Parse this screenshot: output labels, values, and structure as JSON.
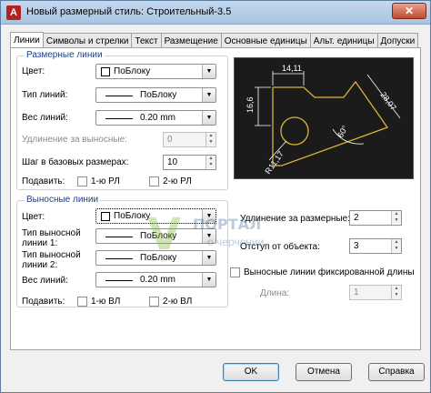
{
  "window": {
    "title": "Новый размерный стиль: Строительный-3.5",
    "icon_letter": "A",
    "close_symbol": "✕"
  },
  "tabs": [
    {
      "label": "Линии",
      "active": true
    },
    {
      "label": "Символы и стрелки"
    },
    {
      "label": "Текст"
    },
    {
      "label": "Размещение"
    },
    {
      "label": "Основные единицы"
    },
    {
      "label": "Альт. единицы"
    },
    {
      "label": "Допуски"
    }
  ],
  "dim_lines": {
    "group_title": "Размерные линии",
    "color_label": "Цвет:",
    "color_value": "ПоБлоку",
    "linetype_label": "Тип линий:",
    "linetype_value": "ПоБлоку",
    "lineweight_label": "Вес линий:",
    "lineweight_value": "0.20 mm",
    "extension_label": "Удлинение за выносные:",
    "extension_value": "0",
    "baseline_label": "Шаг в базовых размерах:",
    "baseline_value": "10",
    "suppress_label": "Подавить:",
    "suppress_1": "1-ю РЛ",
    "suppress_2": "2-ю РЛ"
  },
  "ext_lines": {
    "group_title": "Выносные линии",
    "color_label": "Цвет:",
    "color_value": "ПоБлоку",
    "linetype1_label_a": "Тип выносной",
    "linetype1_label_b": "линии 1:",
    "linetype1_value": "ПоБлоку",
    "linetype2_label_a": "Тип выносной",
    "linetype2_label_b": "линии 2:",
    "linetype2_value": "ПоБлоку",
    "lineweight_label": "Вес линий:",
    "lineweight_value": "0.20 mm",
    "suppress_label": "Подавить:",
    "suppress_1": "1-ю ВЛ",
    "suppress_2": "2-ю ВЛ",
    "extend_label": "Удлинение за размерные:",
    "extend_value": "2",
    "offset_label": "Отступ от объекта:",
    "offset_value": "3",
    "fixed_label": "Выносные линии фиксированной длины",
    "length_label": "Длина:",
    "length_value": "1"
  },
  "preview": {
    "dim_top": "14,11",
    "dim_left": "16,6",
    "dim_right": "28,07",
    "dim_angle": "60°",
    "dim_radius": "R11,17"
  },
  "watermark": {
    "letter": "V",
    "line1": "ПОРТАЛ",
    "line2": "о черчении"
  },
  "buttons": {
    "ok": "OK",
    "cancel": "Отмена",
    "help": "Справка"
  },
  "colors": {
    "accent": "#1e3f8a",
    "preview_bg": "#1b1b1b",
    "preview_object": "#d9b33a",
    "preview_dims": "#ffffff"
  }
}
